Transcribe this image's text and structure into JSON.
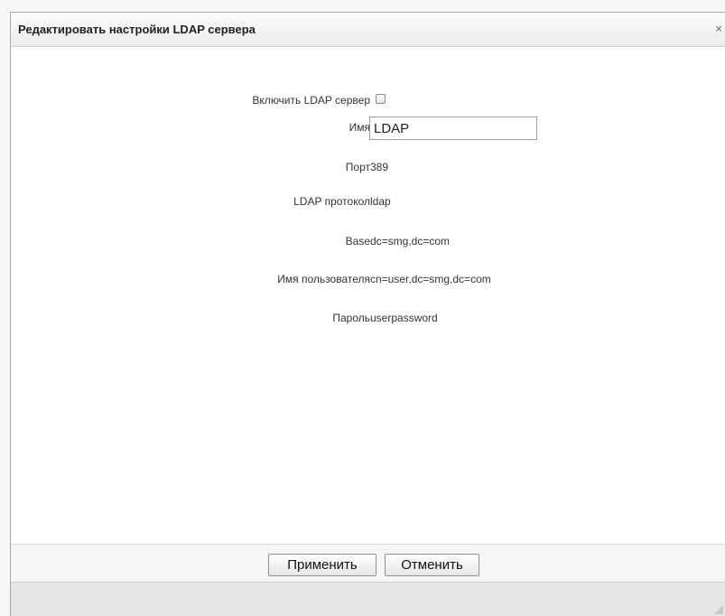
{
  "dialog": {
    "title": "Редактировать настройки LDAP сервера",
    "close_glyph": "×"
  },
  "form": {
    "enable_label": "Включить LDAP сервер",
    "enable_checked": false,
    "name_label": "Имя",
    "name_value": "LDAP",
    "port_label": "Порт",
    "port_value": "389",
    "protocol_label": "LDAP протокол",
    "protocol_value": "ldap",
    "base_label": "Base",
    "base_value": "dc=smg,dc=com",
    "username_label": "Имя пользователя",
    "username_value": "cn=user,dc=smg,dc=com",
    "password_label": "Пароль",
    "password_value": "userpassword"
  },
  "footer": {
    "apply_label": "Применить",
    "cancel_label": "Отменить"
  }
}
